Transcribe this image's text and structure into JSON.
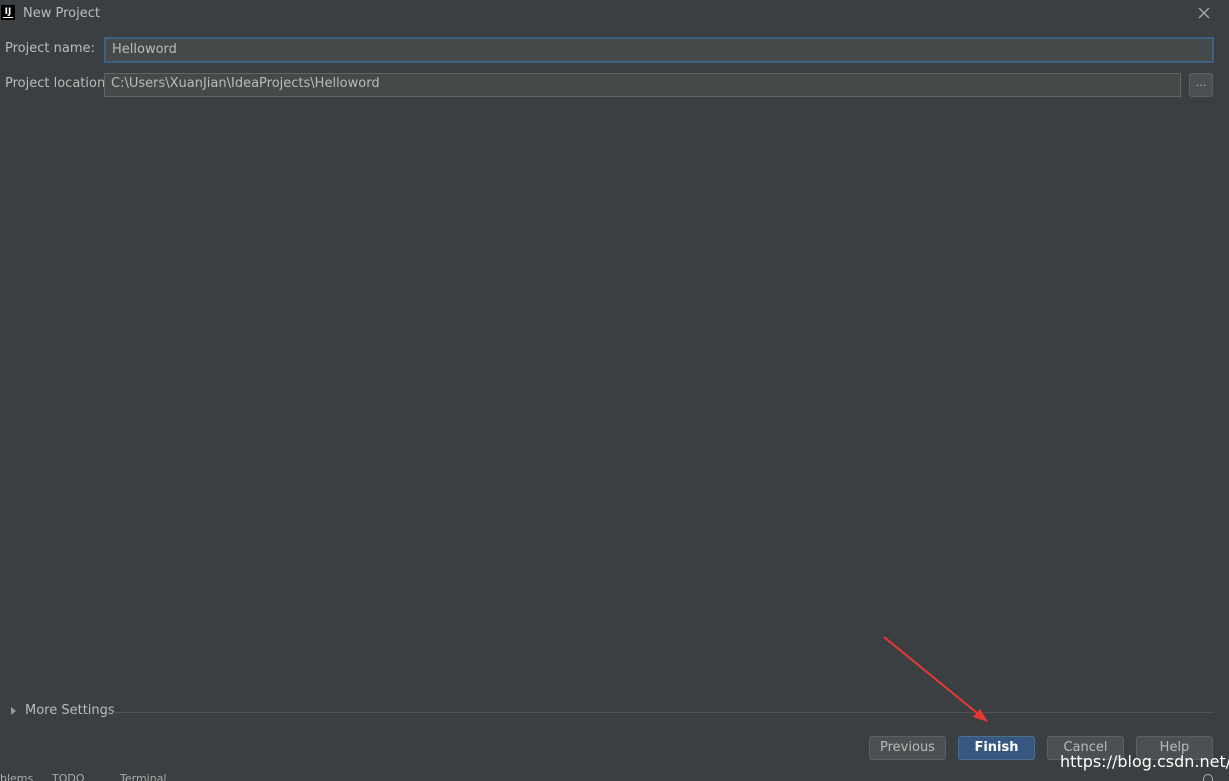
{
  "window": {
    "title": "New Project",
    "icon": "intellij-logo",
    "logo_text": "IJ",
    "close_icon": "close-icon"
  },
  "form": {
    "project_name": {
      "label": "Project name:",
      "value": "Helloword"
    },
    "project_location": {
      "label": "Project location:",
      "value": "C:\\Users\\XuanJian\\IdeaProjects\\Helloword",
      "browse_label": "..."
    }
  },
  "more_settings": {
    "label": "More Settings",
    "icon": "caret-right-icon"
  },
  "buttons": {
    "previous": "Previous",
    "finish": "Finish",
    "cancel": "Cancel",
    "help": "Help"
  },
  "statusbar": {
    "items": [
      "blems",
      "TODO",
      "Terminal"
    ]
  },
  "watermark": "https://blog.csdn.net/m",
  "colors": {
    "background": "#3c3f41",
    "field_background": "#45494a",
    "focus_border": "#3d6185",
    "primary_button": "#365880",
    "annotation_arrow": "#e53935"
  }
}
